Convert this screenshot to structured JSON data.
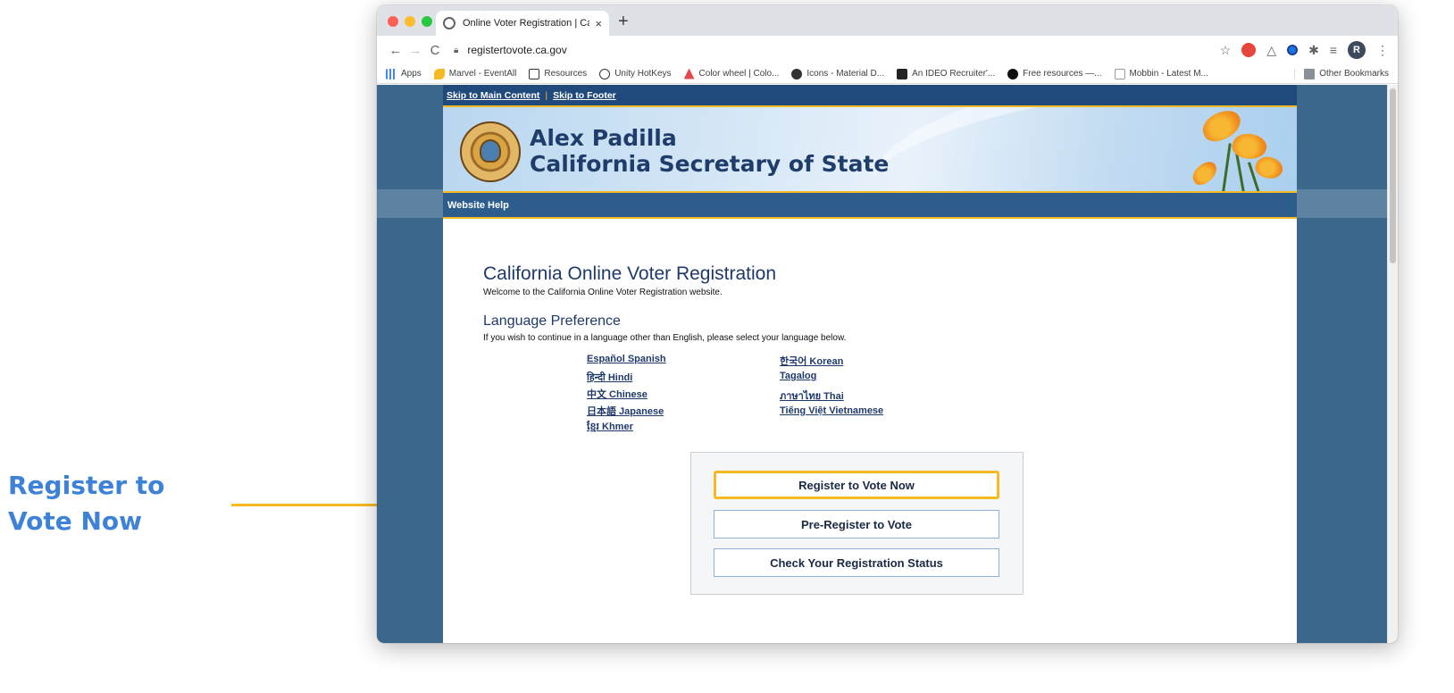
{
  "annotation": {
    "label_line1": "Register to",
    "label_line2": "Vote Now",
    "accent_color": "#3d82d8",
    "line_color": "#f5b921"
  },
  "browser": {
    "tab": {
      "title": "Online Voter Registration | Cali",
      "close": "×",
      "favicon": "globe-icon"
    },
    "new_tab": "+",
    "url": "registertovote.ca.gov",
    "nav": {
      "back": "←",
      "forward": "→",
      "reload": "C"
    },
    "toolbar_icons": {
      "star": "☆",
      "warning": "△",
      "puzzle": "✱",
      "queue": "≡",
      "menu": "⋮"
    },
    "profile_initial": "R",
    "bookmarks": [
      {
        "label": "Apps",
        "icon": "apps-grid-icon"
      },
      {
        "label": "Marvel - EventAll",
        "icon": "marvel-icon"
      },
      {
        "label": "Resources",
        "icon": "notion-icon"
      },
      {
        "label": "Unity HotKeys",
        "icon": "unity-icon"
      },
      {
        "label": "Color wheel | Colo...",
        "icon": "adobe-icon"
      },
      {
        "label": "Icons - Material D...",
        "icon": "github-icon"
      },
      {
        "label": "An IDEO Recruiter'...",
        "icon": "ideo-icon"
      },
      {
        "label": "Free resources —...",
        "icon": "dot-icon"
      },
      {
        "label": "Mobbin - Latest M...",
        "icon": "mobbin-icon"
      }
    ],
    "other_bookmarks": "Other Bookmarks"
  },
  "site": {
    "skip_main": "Skip to Main Content",
    "skip_separator": "|",
    "skip_footer": "Skip to Footer",
    "header_line1": "Alex Padilla",
    "header_line2": "California Secretary of State",
    "help_link": "Website Help",
    "colors": {
      "nav_dark": "#204a7b",
      "nav": "#2c5d8c",
      "accent": "#f5b921",
      "heading": "#1f3a6a",
      "side": "#3b678d"
    }
  },
  "main": {
    "title": "California Online Voter Registration",
    "welcome": "Welcome to the California Online Voter Registration website.",
    "language_heading": "Language Preference",
    "language_instruction": "If you wish to continue in a language other than English, please select your language below.",
    "languages_left": [
      "Español Spanish",
      "हिन्दी Hindi",
      "中文 Chinese",
      "日本語 Japanese",
      "ខ្មែរ Khmer"
    ],
    "languages_right": [
      "한국어 Korean",
      "Tagalog",
      "ภาษาไทย Thai",
      "Tiếng Việt Vietnamese"
    ],
    "buttons": [
      "Register to Vote Now",
      "Pre-Register to Vote",
      "Check Your Registration Status"
    ]
  }
}
